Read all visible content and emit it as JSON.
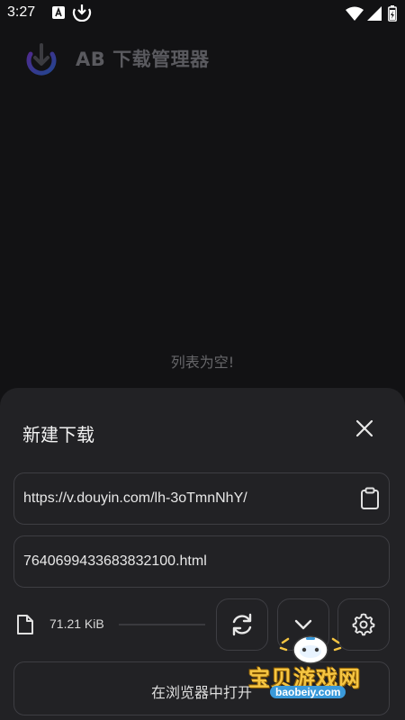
{
  "status_bar": {
    "time": "3:27"
  },
  "header": {
    "title": "AB 下载管理器"
  },
  "main": {
    "empty_message": "列表为空!"
  },
  "new_download_sheet": {
    "title": "新建下载",
    "url_value": "https://v.douyin.com/lh-3oTmnNhY/",
    "file_name_value": "7640699433683832100.html",
    "file_size": "71.21 KiB",
    "progress_fraction": 0,
    "open_in_browser_label": "在浏览器中打开"
  },
  "watermark": {
    "main_text": "宝贝游戏网",
    "sub_text": "baobeiy.com"
  },
  "icons": {
    "close": "close-icon",
    "paste": "clipboard-icon",
    "file": "file-icon",
    "refresh": "refresh-icon",
    "expand": "chevron-down-icon",
    "settings": "gear-icon"
  },
  "colors": {
    "background": "#121214",
    "sheet": "#222225",
    "border": "#3e3e43",
    "logo_gradient_start": "#6a3df0",
    "logo_gradient_end": "#2f6ff2"
  }
}
